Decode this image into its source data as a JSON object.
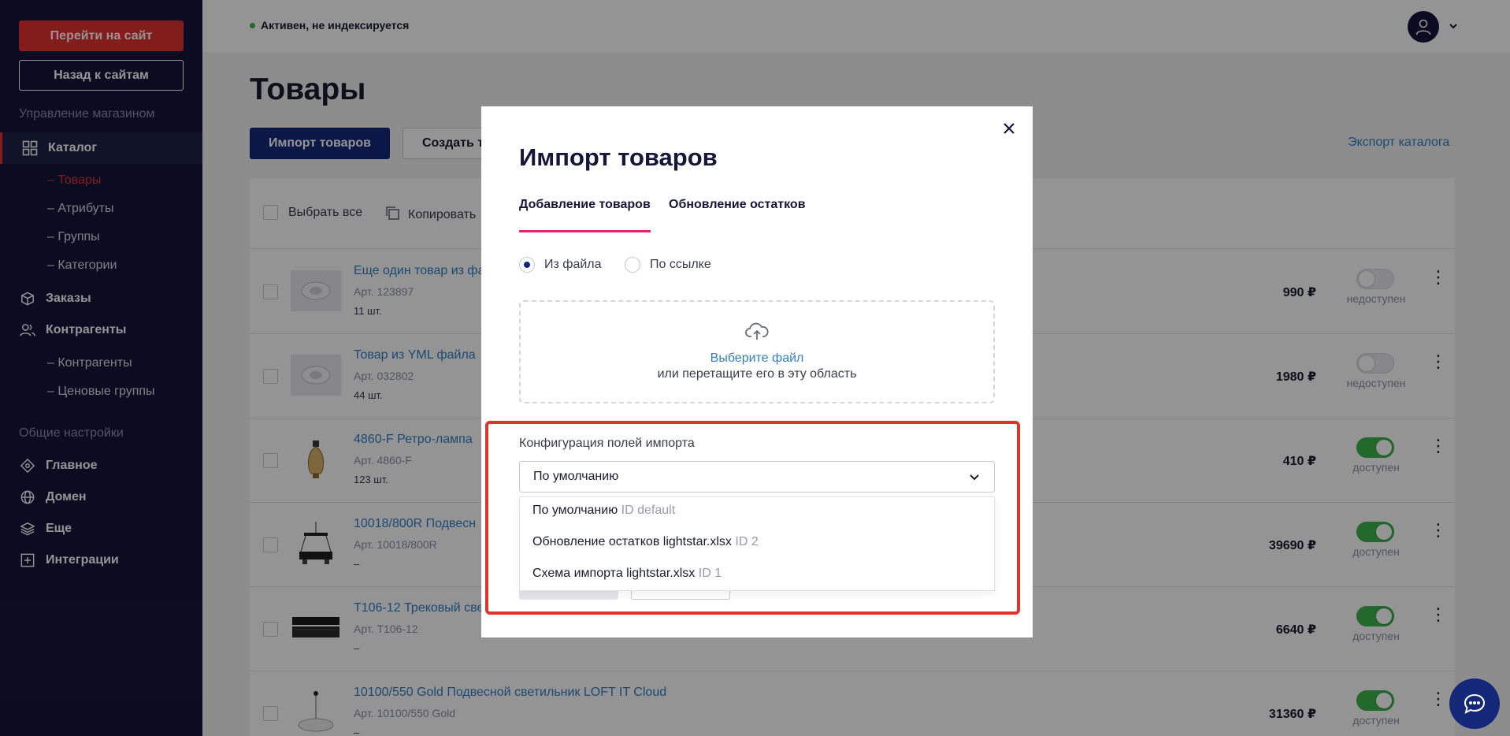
{
  "sidebar": {
    "go_to_site": "Перейти на сайт",
    "back_to_sites": "Назад к сайтам",
    "section_shop": "Управление магазином",
    "catalog": "Каталог",
    "catalog_sub": [
      "– Товары",
      "– Атрибуты",
      "– Группы",
      "– Категории"
    ],
    "orders": "Заказы",
    "counterparties": "Контрагенты",
    "counterparties_sub": [
      "– Контрагенты",
      "– Ценовые группы"
    ],
    "section_general": "Общие настройки",
    "main": "Главное",
    "domain": "Домен",
    "more": "Еще",
    "integrations": "Интеграции"
  },
  "topbar": {
    "status": "Активен, не индексируется"
  },
  "main": {
    "title": "Товары",
    "import_btn": "Импорт товаров",
    "create_btn": "Создать т",
    "export_link": "Экспорт каталога",
    "select_all": "Выбрать все",
    "copy_action": "Копировать",
    "rows": [
      {
        "name": "Еще один товар из фа",
        "art": "Арт. 123897",
        "qty": "11 шт.",
        "price": "990 ₽",
        "available": false,
        "avail_text": "недоступен"
      },
      {
        "name": "Товар из YML файла",
        "art": "Арт. 032802",
        "qty": "44 шт.",
        "price": "1980 ₽",
        "available": false,
        "avail_text": "недоступен"
      },
      {
        "name": "4860-F Ретро-лампа",
        "art": "Арт. 4860-F",
        "qty": "123 шт.",
        "price": "410 ₽",
        "available": true,
        "avail_text": "доступен"
      },
      {
        "name": "10018/800R Подвесн",
        "art": "Арт. 10018/800R",
        "qty": "–",
        "price": "39690 ₽",
        "available": true,
        "avail_text": "доступен"
      },
      {
        "name": "T106-12 Трековый све",
        "art": "Арт. T106-12",
        "qty": "–",
        "price": "6640 ₽",
        "available": true,
        "avail_text": "доступен"
      },
      {
        "name": "10100/550 Gold Подвесной светильник LOFT IT Cloud",
        "art": "Арт. 10100/550 Gold",
        "qty": "–",
        "price": "31360 ₽",
        "available": true,
        "avail_text": "доступен"
      }
    ]
  },
  "modal": {
    "title": "Импорт товаров",
    "tabs": [
      "Добавление товаров",
      "Обновление остатков"
    ],
    "radio_file": "Из файла",
    "radio_link": "По ссылке",
    "choose_file": "Выберите файл",
    "drag_hint": "или перетащите его в эту область",
    "config_label": "Конфигурация полей импорта",
    "selected": "По умолчанию",
    "options": [
      {
        "label": "По умолчанию",
        "id": "ID default"
      },
      {
        "label": "Обновление остатков lightstar.xlsx",
        "id": "ID 2"
      },
      {
        "label": "Схема импорта lightstar.xlsx",
        "id": "ID 1"
      }
    ]
  },
  "colors": {
    "accent": "#e2332f",
    "brand_blue": "#14287a",
    "link": "#2f7fc5",
    "sidebar_bg": "#14163a",
    "highlight": "#e0332e",
    "toggle_on": "#3bb54a"
  }
}
